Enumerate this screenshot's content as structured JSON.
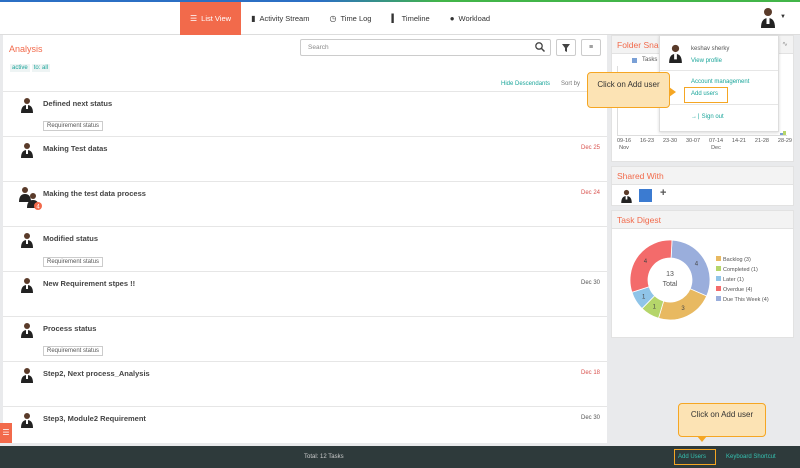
{
  "nav": {
    "items": [
      {
        "label": "List View",
        "icon": "list-icon",
        "active": true
      },
      {
        "label": "Activity Stream",
        "icon": "comment-icon",
        "active": false
      },
      {
        "label": "Time Log",
        "icon": "clock-icon",
        "active": false
      },
      {
        "label": "Timeline",
        "icon": "bar-chart-icon",
        "active": false
      },
      {
        "label": "Workload",
        "icon": "user-icon",
        "active": false
      }
    ]
  },
  "analysis": {
    "title": "Analysis",
    "search_placeholder": "Search",
    "filters": [
      "active",
      "to: all"
    ],
    "hide_descendants": "Hide Descendants",
    "sort_by": "Sort by"
  },
  "tasks": [
    {
      "name": "Defined next status",
      "date": "",
      "badge": "Requirement status"
    },
    {
      "name": "Making Test datas",
      "date": "Dec 25",
      "date_color": "red",
      "badge": ""
    },
    {
      "name": "Making the test data process",
      "date": "Dec 24",
      "date_color": "red",
      "badge": "",
      "multi_avatar": true,
      "avatar_count": "4"
    },
    {
      "name": "Modified status",
      "date": "",
      "badge": "Requirement status"
    },
    {
      "name": "New Requirement stpes !!",
      "date": "Dec 30",
      "badge": ""
    },
    {
      "name": "Process status",
      "date": "",
      "badge": "Requirement status"
    },
    {
      "name": "Step2, Next process_Analysis",
      "date": "Dec 18",
      "date_color": "red",
      "badge": ""
    },
    {
      "name": "Step3, Module2 Requirement",
      "date": "Dec 30",
      "badge": ""
    }
  ],
  "folder_snapshot": {
    "title": "Folder Snap",
    "legend": "Tasks",
    "x_labels": [
      {
        "top": "09-16",
        "bottom": "Nov"
      },
      {
        "top": "16-23",
        "bottom": ""
      },
      {
        "top": "23-30",
        "bottom": ""
      },
      {
        "top": "30-07",
        "bottom": ""
      },
      {
        "top": "07-14",
        "bottom": "Dec"
      },
      {
        "top": "14-21",
        "bottom": ""
      },
      {
        "top": "21-28",
        "bottom": ""
      },
      {
        "top": "28-29",
        "bottom": ""
      }
    ]
  },
  "shared_with": {
    "title": "Shared With",
    "add_symbol": "+"
  },
  "task_digest": {
    "title": "Task Digest",
    "center_value": "13",
    "center_label": "Total",
    "legend": [
      {
        "label": "Backlog (3)",
        "color": "#e8b961"
      },
      {
        "label": "Completed (1)",
        "color": "#b5d56a"
      },
      {
        "label": "Later (1)",
        "color": "#8fc4e8"
      },
      {
        "label": "Overdue (4)",
        "color": "#f36b6b"
      },
      {
        "label": "Due This Week (4)",
        "color": "#9aaedc"
      }
    ]
  },
  "chart_data": {
    "type": "pie",
    "title": "Task Digest",
    "categories": [
      "Due This Week",
      "Backlog",
      "Completed",
      "Later",
      "Overdue"
    ],
    "values": [
      4,
      3,
      1,
      1,
      4
    ],
    "colors": [
      "#9aaedc",
      "#e8b961",
      "#b5d56a",
      "#8fc4e8",
      "#f36b6b"
    ],
    "total": 13
  },
  "profile_menu": {
    "name": "keshav sherky",
    "view_profile": "View profile",
    "account_management": "Account management",
    "add_users": "Add users",
    "sign_out": "Sign out"
  },
  "callouts": {
    "top": "Click on Add user",
    "bottom": "Click on Add user"
  },
  "footer": {
    "total": "Total: 12 Tasks",
    "add_users": "Add Users",
    "keyboard_shortcut": "Keyboard Shortcut"
  },
  "colors": {
    "accent": "#f26a4b",
    "teal": "#1aa59a",
    "footer": "#2e3a3b"
  }
}
